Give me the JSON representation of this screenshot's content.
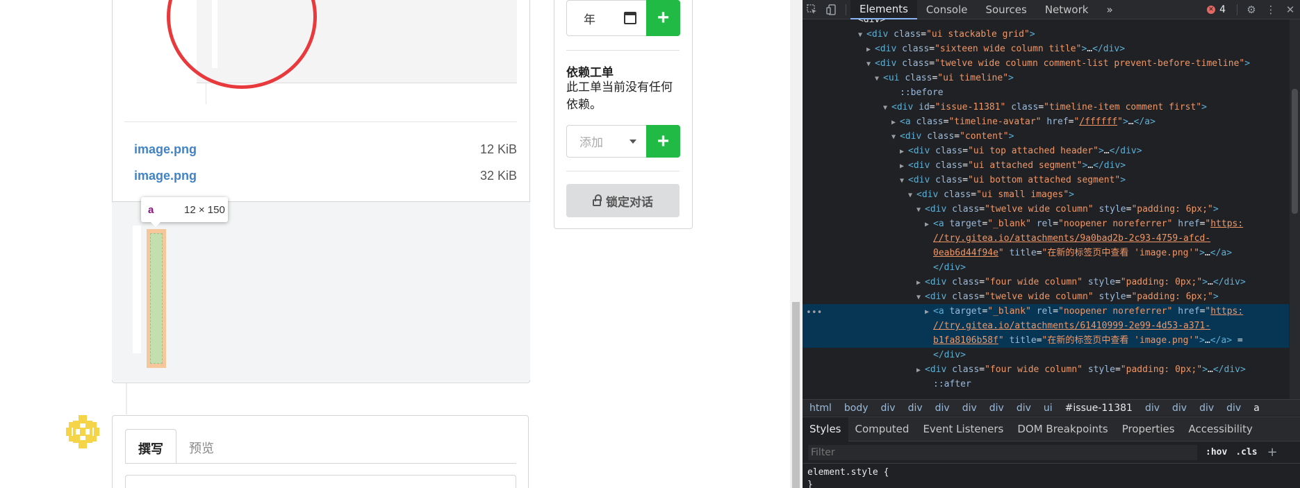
{
  "attachments": [
    {
      "name": "image.png",
      "size": "12 KiB"
    },
    {
      "name": "image.png",
      "size": "32 KiB"
    }
  ],
  "inspector_tooltip": {
    "tag": "a",
    "dims": "12 × 150"
  },
  "sidebar": {
    "date_placeholder": "年",
    "plus_label": "+",
    "dependencies_title": "依赖工单",
    "dependencies_text": "此工单当前没有任何依赖。",
    "add_dependency_placeholder": "添加",
    "lock_label": "锁定对话"
  },
  "editor": {
    "tabs": [
      "撰写",
      "预览"
    ]
  },
  "colors": {
    "accent_green": "#21ba45",
    "link_blue": "#4183c4",
    "annotation_red": "#e8393c"
  },
  "devtools": {
    "tabs": [
      "Elements",
      "Console",
      "Sources",
      "Network"
    ],
    "more_tabs": "»",
    "error_count": "4",
    "dom_lines": [
      {
        "indent": 6,
        "tri": "",
        "html": "<div>",
        "raw": "&lt;div&gt;"
      },
      {
        "indent": 7,
        "tri": "▼",
        "raw": "<span class=\"tg\">&lt;div</span> <span class=\"an\">class</span>=<span class=\"av\">\"ui stackable grid\"</span><span class=\"tg\">&gt;</span>"
      },
      {
        "indent": 8,
        "tri": "▶",
        "raw": "<span class=\"tg\">&lt;div</span> <span class=\"an\">class</span>=<span class=\"av\">\"sixteen wide column title\"</span><span class=\"tg\">&gt;</span><span class=\"tx\">…</span><span class=\"tg\">&lt;/div&gt;</span>"
      },
      {
        "indent": 8,
        "tri": "▼",
        "raw": "<span class=\"tg\">&lt;div</span> <span class=\"an\">class</span>=<span class=\"av\">\"twelve wide column comment-list prevent-before-timeline\"</span><span class=\"tg\">&gt;</span>"
      },
      {
        "indent": 9,
        "tri": "▼",
        "raw": "<span class=\"tg\">&lt;ui</span> <span class=\"an\">class</span>=<span class=\"av\">\"ui timeline\"</span><span class=\"tg\">&gt;</span>"
      },
      {
        "indent": 11,
        "tri": "",
        "raw": "<span class=\"pse\">::before</span>"
      },
      {
        "indent": 10,
        "tri": "▼",
        "raw": "<span class=\"tg\">&lt;div</span> <span class=\"an\">id</span>=<span class=\"av\">\"issue-11381\"</span> <span class=\"an\">class</span>=<span class=\"av\">\"timeline-item comment first\"</span><span class=\"tg\">&gt;</span>"
      },
      {
        "indent": 11,
        "tri": "▶",
        "raw": "<span class=\"tg\">&lt;a</span> <span class=\"an\">class</span>=<span class=\"av\">\"timeline-avatar\"</span> <span class=\"an\">href</span>=<span class=\"av\">\"</span><span class=\"lnk\">/ffffff</span><span class=\"av\">\"</span><span class=\"tg\">&gt;</span><span class=\"tx\">…</span><span class=\"tg\">&lt;/a&gt;</span>"
      },
      {
        "indent": 11,
        "tri": "▼",
        "raw": "<span class=\"tg\">&lt;div</span> <span class=\"an\">class</span>=<span class=\"av\">\"content\"</span><span class=\"tg\">&gt;</span>"
      },
      {
        "indent": 12,
        "tri": "▶",
        "raw": "<span class=\"tg\">&lt;div</span> <span class=\"an\">class</span>=<span class=\"av\">\"ui top attached header\"</span><span class=\"tg\">&gt;</span><span class=\"tx\">…</span><span class=\"tg\">&lt;/div&gt;</span>"
      },
      {
        "indent": 12,
        "tri": "▶",
        "raw": "<span class=\"tg\">&lt;div</span> <span class=\"an\">class</span>=<span class=\"av\">\"ui attached segment\"</span><span class=\"tg\">&gt;</span><span class=\"tx\">…</span><span class=\"tg\">&lt;/div&gt;</span>"
      },
      {
        "indent": 12,
        "tri": "▼",
        "raw": "<span class=\"tg\">&lt;div</span> <span class=\"an\">class</span>=<span class=\"av\">\"ui bottom attached segment\"</span><span class=\"tg\">&gt;</span>"
      },
      {
        "indent": 13,
        "tri": "▼",
        "raw": "<span class=\"tg\">&lt;div</span> <span class=\"an\">class</span>=<span class=\"av\">\"ui small images\"</span><span class=\"tg\">&gt;</span>"
      },
      {
        "indent": 14,
        "tri": "▼",
        "raw": "<span class=\"tg\">&lt;div</span> <span class=\"an\">class</span>=<span class=\"av\">\"twelve wide column\"</span> <span class=\"an\">style</span>=<span class=\"av\">\"padding: 6px;\"</span><span class=\"tg\">&gt;</span>"
      },
      {
        "indent": 15,
        "tri": "▶",
        "raw": "<span class=\"tg\">&lt;a</span> <span class=\"an\">target</span>=<span class=\"av\">\"_blank\"</span> <span class=\"an\">rel</span>=<span class=\"av\">\"noopener noreferrer\"</span> <span class=\"an\">href</span>=<span class=\"av\">\"</span><span class=\"lnk\">https:</span>"
      },
      {
        "indent": 15,
        "tri": "",
        "raw": "<span class=\"lnk\">//try.gitea.io/attachments/9a0bad2b-2c93-4759-afcd-</span>"
      },
      {
        "indent": 15,
        "tri": "",
        "raw": "<span class=\"lnk\">0eab6d44f94e</span><span class=\"av\">\"</span> <span class=\"an\">title</span>=<span class=\"av\">\"在新的标签页中查看 'image.png'\"</span><span class=\"tg\">&gt;</span><span class=\"tx\">…</span><span class=\"tg\">&lt;/a&gt;</span>"
      },
      {
        "indent": 15,
        "tri": "",
        "raw": "<span class=\"tg\">&lt;/div&gt;</span>"
      },
      {
        "indent": 14,
        "tri": "▶",
        "raw": "<span class=\"tg\">&lt;div</span> <span class=\"an\">class</span>=<span class=\"av\">\"four wide column\"</span> <span class=\"an\">style</span>=<span class=\"av\">\"padding: 0px;\"</span><span class=\"tg\">&gt;</span><span class=\"tx\">…</span><span class=\"tg\">&lt;/div&gt;</span>"
      },
      {
        "indent": 14,
        "tri": "▼",
        "raw": "<span class=\"tg\">&lt;div</span> <span class=\"an\">class</span>=<span class=\"av\">\"twelve wide column\"</span> <span class=\"an\">style</span>=<span class=\"av\">\"padding: 6px;\"</span><span class=\"tg\">&gt;</span>"
      },
      {
        "indent": 15,
        "tri": "▶",
        "sel": true,
        "raw": "<span class=\"tg\">&lt;a</span> <span class=\"an\">target</span>=<span class=\"av\">\"_blank\"</span> <span class=\"an\">rel</span>=<span class=\"av\">\"noopener noreferrer\"</span> <span class=\"an\">href</span>=<span class=\"av\">\"</span><span class=\"lnk\">https:</span>"
      },
      {
        "indent": 15,
        "tri": "",
        "sel": true,
        "raw": "<span class=\"lnk\">//try.gitea.io/attachments/61410999-2e99-4d53-a371-</span>"
      },
      {
        "indent": 15,
        "tri": "",
        "sel": true,
        "raw": "<span class=\"lnk\">b1fa8106b58f</span><span class=\"av\">\"</span> <span class=\"an\">title</span>=<span class=\"av\">\"在新的标签页中查看 'image.png'\"</span><span class=\"tg\">&gt;</span><span class=\"tx\">…</span><span class=\"tg\">&lt;/a&gt;</span> <span class=\"tx\">=</span>"
      },
      {
        "indent": 15,
        "tri": "",
        "raw": "<span class=\"tg\">&lt;/div&gt;</span>"
      },
      {
        "indent": 14,
        "tri": "▶",
        "raw": "<span class=\"tg\">&lt;div</span> <span class=\"an\">class</span>=<span class=\"av\">\"four wide column\"</span> <span class=\"an\">style</span>=<span class=\"av\">\"padding: 0px;\"</span><span class=\"tg\">&gt;</span><span class=\"tx\">…</span><span class=\"tg\">&lt;/div&gt;</span>"
      },
      {
        "indent": 15,
        "tri": "",
        "raw": "<span class=\"pse\">::after</span>"
      }
    ],
    "breadcrumbs": [
      "html",
      "body",
      "div",
      "div",
      "div",
      "div",
      "div",
      "div",
      "ui",
      "#issue-11381",
      "div",
      "div",
      "div",
      "div",
      "a"
    ],
    "styles_tabs": [
      "Styles",
      "Computed",
      "Event Listeners",
      "DOM Breakpoints",
      "Properties",
      "Accessibility"
    ],
    "filter_placeholder": "Filter",
    "hov_label": ":hov",
    "cls_label": ".cls",
    "element_style": "element.style {",
    "element_style_close": "}"
  }
}
